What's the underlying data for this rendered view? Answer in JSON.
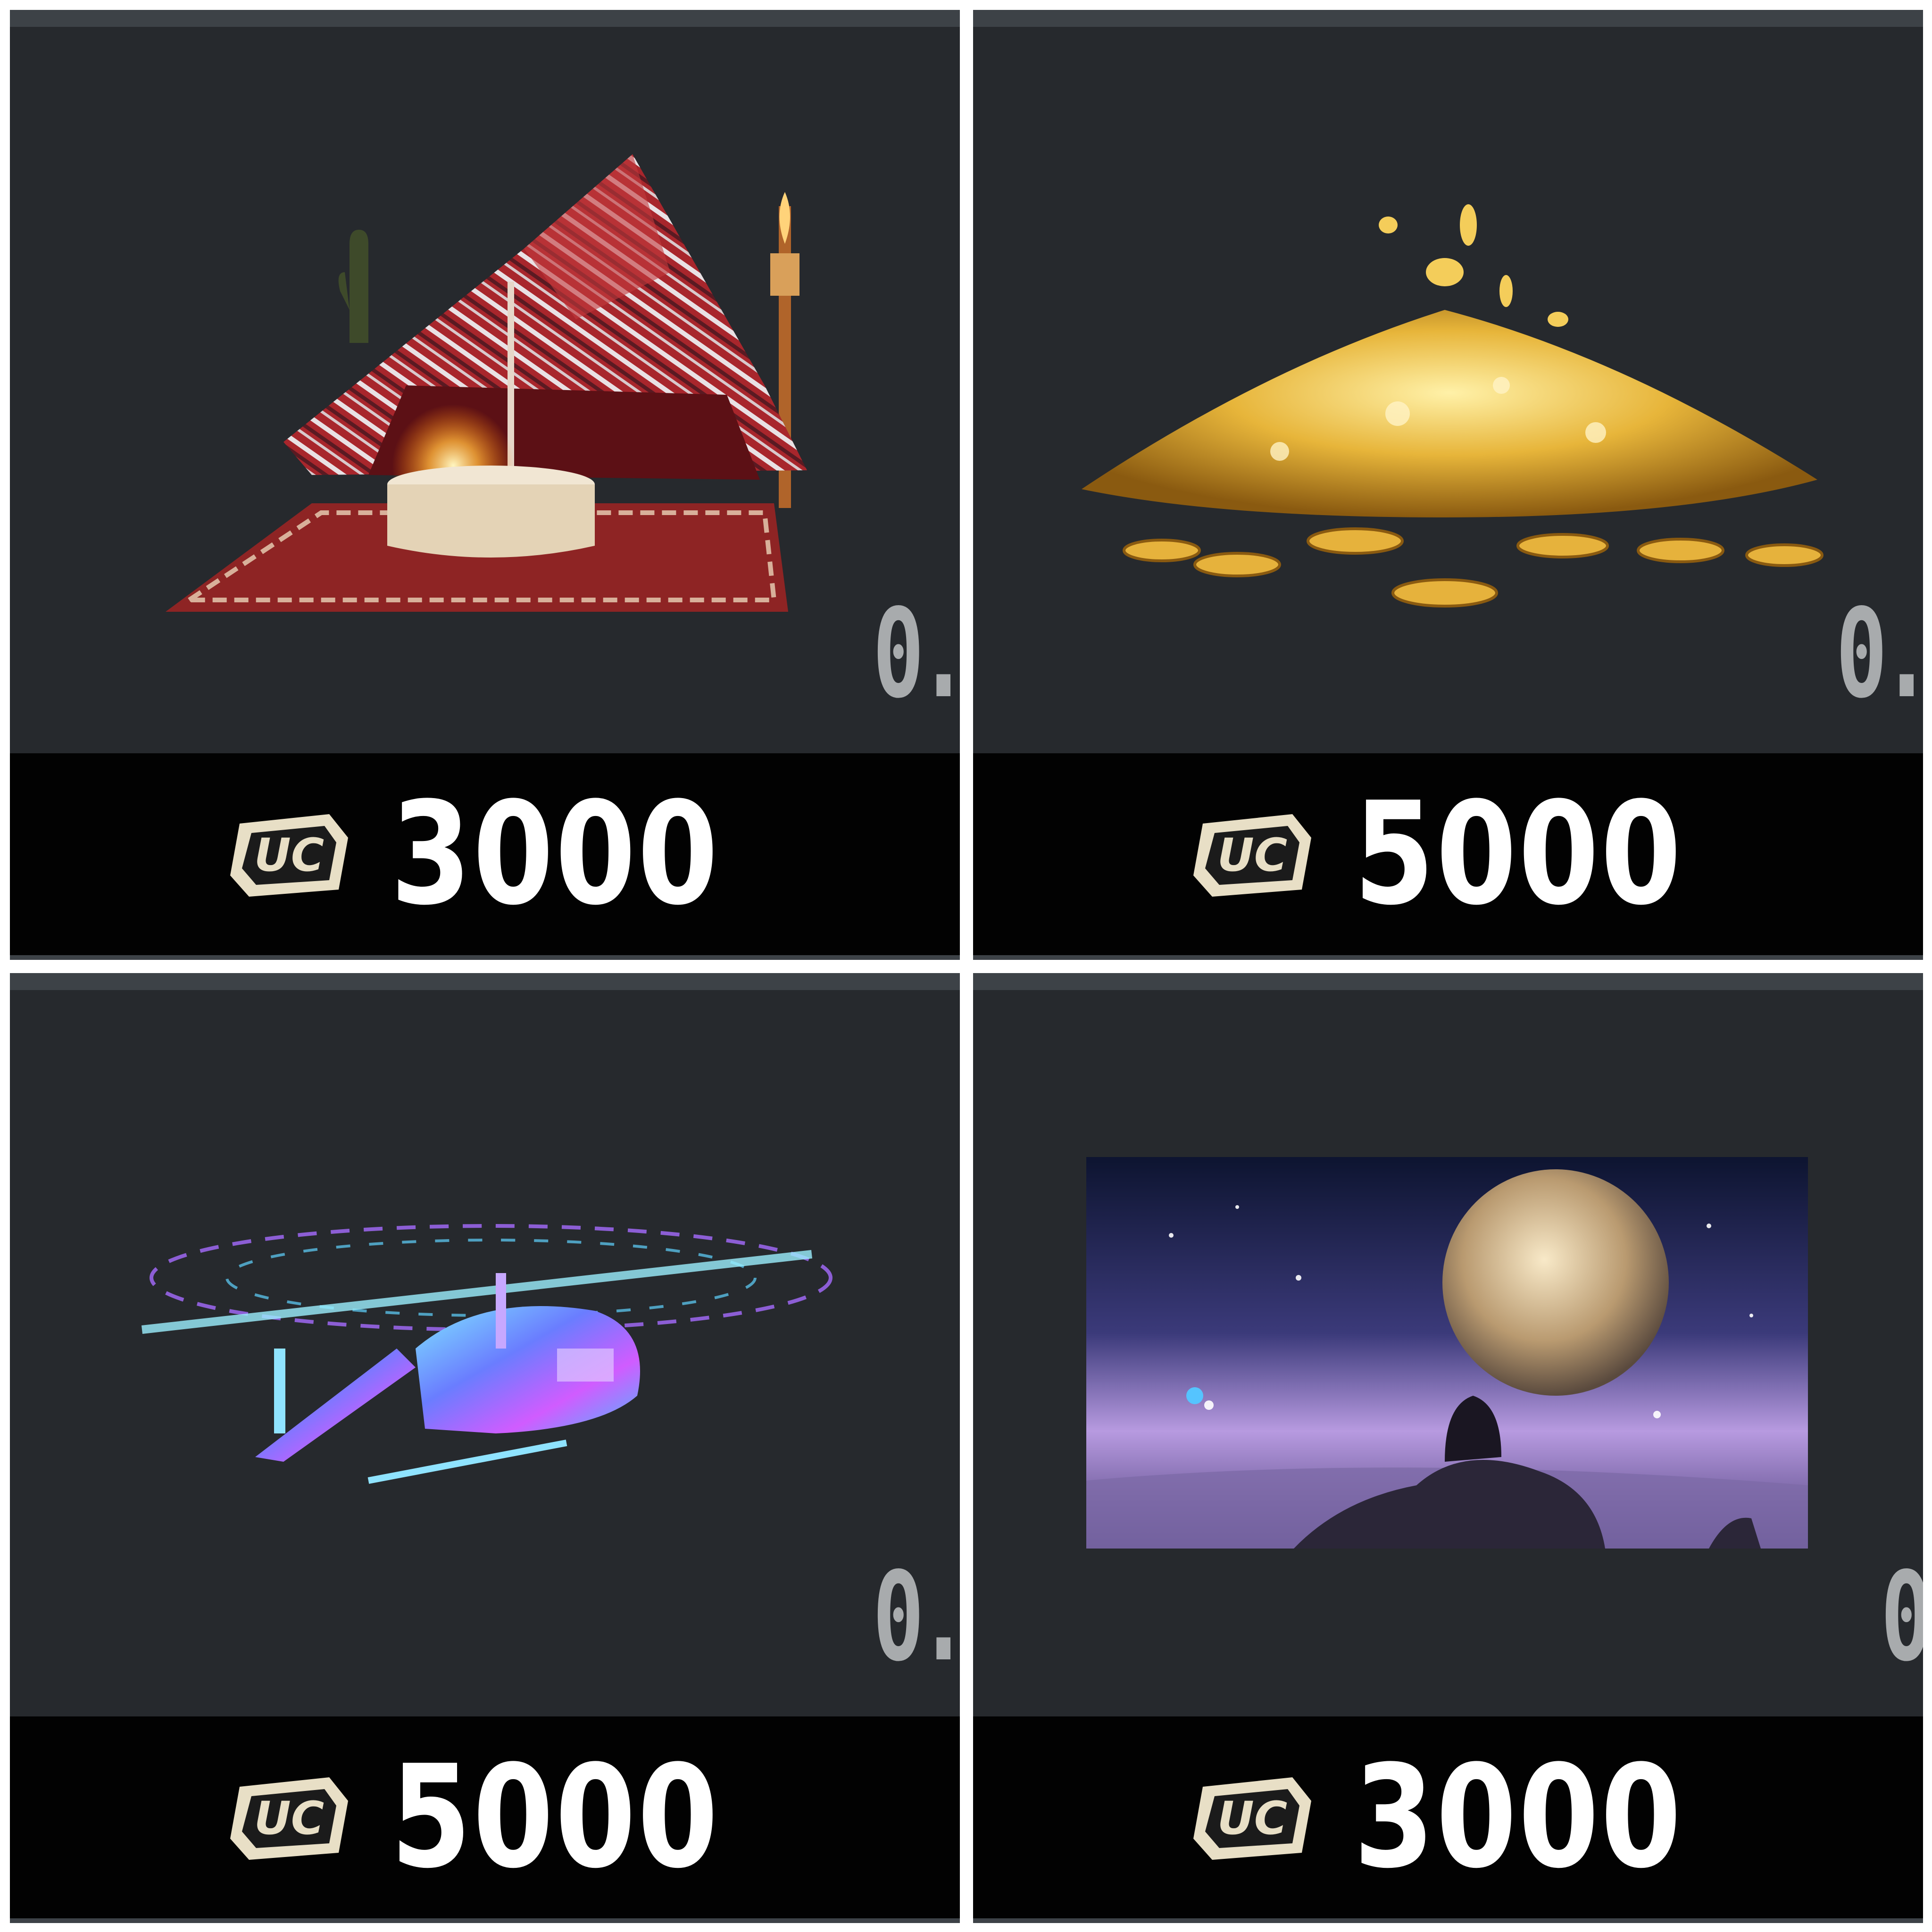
{
  "tiles": [
    {
      "item": "tent",
      "currency": "UC",
      "price": "3000",
      "side_mark": "0."
    },
    {
      "item": "coin-pile",
      "currency": "UC",
      "price": "5000",
      "side_mark": "0."
    },
    {
      "item": "helicopter",
      "currency": "UC",
      "price": "5000",
      "side_mark": "0."
    },
    {
      "item": "moon-scene",
      "currency": "UC",
      "price": "3000",
      "side_mark": "0"
    }
  ],
  "colors": {
    "tile_bg": "#26292d",
    "tile_border": "#3d4247",
    "price_bar": "#020202",
    "price_text": "#ffffff",
    "uc_badge": "#e8dfc6"
  }
}
